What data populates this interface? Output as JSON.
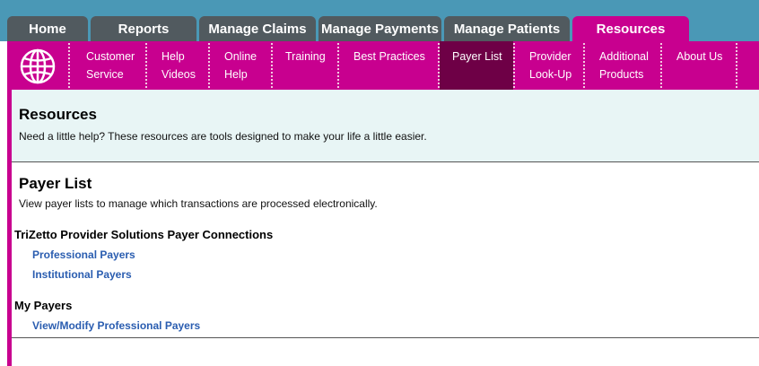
{
  "tabs": [
    {
      "label": "Home"
    },
    {
      "label": "Reports"
    },
    {
      "label": "Manage Claims"
    },
    {
      "label": "Manage Payments"
    },
    {
      "label": "Manage Patients"
    },
    {
      "label": "Resources",
      "active": true
    }
  ],
  "subnav": {
    "icon": "globe-icon",
    "items": [
      {
        "line1": "Customer",
        "line2": "Service"
      },
      {
        "line1": "Help",
        "line2": "Videos"
      },
      {
        "line1": "Online",
        "line2": "Help"
      },
      {
        "line1": "Training",
        "line2": ""
      },
      {
        "line1": "Best Practices",
        "line2": ""
      },
      {
        "line1": "Payer List",
        "line2": "",
        "active": true
      },
      {
        "line1": "Provider",
        "line2": "Look-Up"
      },
      {
        "line1": "Additional",
        "line2": "Products"
      },
      {
        "line1": "About Us",
        "line2": ""
      }
    ]
  },
  "intro": {
    "title": "Resources",
    "text": "Need a little help? These resources are tools designed to make your life a little easier."
  },
  "payer_list": {
    "title": "Payer List",
    "text": "View payer lists to manage which transactions are processed electronically."
  },
  "connections": {
    "heading": "TriZetto Provider Solutions Payer Connections",
    "links": [
      "Professional Payers",
      "Institutional Payers"
    ]
  },
  "my_payers": {
    "heading": "My Payers",
    "links": [
      "View/Modify Professional Payers"
    ]
  },
  "colors": {
    "accent": "#c8008f",
    "active_subitem": "#6e0046",
    "tab_bg": "#515a5f",
    "topbar": "#4a98b6",
    "link": "#2a5db0"
  }
}
